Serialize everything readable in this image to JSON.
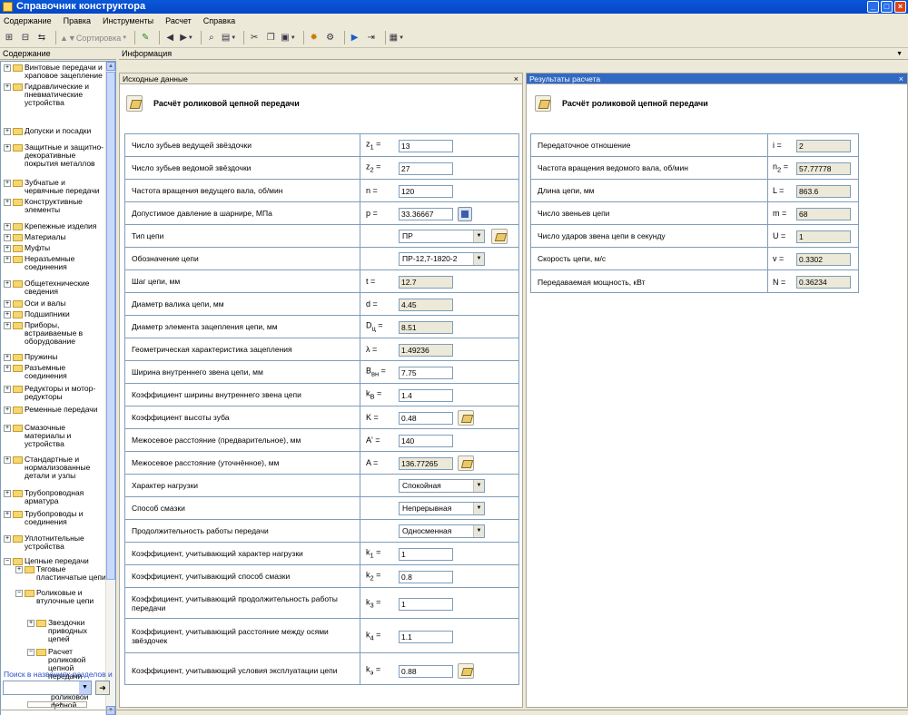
{
  "window": {
    "title": "Справочник конструктора"
  },
  "menu": [
    "Содержание",
    "Правка",
    "Инструменты",
    "Расчет",
    "Справка"
  ],
  "toolbar": {
    "sort_label": "Сортировка"
  },
  "left_pane": {
    "header": "Содержание",
    "tree": [
      {
        "label": "Винтовые передачи и храповое зацепление",
        "level": 0,
        "expander": "+"
      },
      {
        "label": "Гидравлические и пневматические устройства",
        "level": 0,
        "expander": "+"
      },
      {
        "label": "Допуски и посадки",
        "level": 0,
        "expander": "+"
      },
      {
        "label": "Защитные и защитно-декоративные покрытия металлов",
        "level": 0,
        "expander": "+"
      },
      {
        "label": "Зубчатые и червячные передачи",
        "level": 0,
        "expander": "+"
      },
      {
        "label": "Конструктивные элементы",
        "level": 0,
        "expander": "+"
      },
      {
        "label": "Крепежные изделия",
        "level": 0,
        "expander": "+"
      },
      {
        "label": "Материалы",
        "level": 0,
        "expander": "+"
      },
      {
        "label": "Муфты",
        "level": 0,
        "expander": "+"
      },
      {
        "label": "Неразъемные соединения",
        "level": 0,
        "expander": "+"
      },
      {
        "label": "Общетехнические сведения",
        "level": 0,
        "expander": "+"
      },
      {
        "label": "Оси и валы",
        "level": 0,
        "expander": "+"
      },
      {
        "label": "Подшипники",
        "level": 0,
        "expander": "+"
      },
      {
        "label": "Приборы, встраиваемые в оборудование",
        "level": 0,
        "expander": "+"
      },
      {
        "label": "Пружины",
        "level": 0,
        "expander": "+"
      },
      {
        "label": "Разъемные соединения",
        "level": 0,
        "expander": "+"
      },
      {
        "label": "Редукторы и мотор-редукторы",
        "level": 0,
        "expander": "+"
      },
      {
        "label": "Ременные передачи",
        "level": 0,
        "expander": "+"
      },
      {
        "label": "Смазочные материалы и устройства",
        "level": 0,
        "expander": "+"
      },
      {
        "label": "Стандартные и нормализованные детали и узлы",
        "level": 0,
        "expander": "+"
      },
      {
        "label": "Трубопроводная арматура",
        "level": 0,
        "expander": "+"
      },
      {
        "label": "Трубопроводы и соединения",
        "level": 0,
        "expander": "+"
      },
      {
        "label": "Уплотнительные устройства",
        "level": 0,
        "expander": "+"
      },
      {
        "label": "Цепные передачи",
        "level": 0,
        "expander": "−"
      },
      {
        "label": "Тяговые пластинчатые цепи",
        "level": 1,
        "expander": "+"
      },
      {
        "label": "Роликовые и втулочные цепи",
        "level": 1,
        "expander": "−"
      },
      {
        "label": "Звездочки приводных цепей",
        "level": 2,
        "expander": "+"
      },
      {
        "label": "Расчет роликовой цепной передачи",
        "level": 2,
        "expander": "−"
      },
      {
        "label": "Расчет роликовой цепной",
        "level": 3,
        "expander": ""
      }
    ],
    "search_label": "Поиск в названиях разделов и",
    "search_value": ""
  },
  "info": {
    "header": "Информация"
  },
  "input_panel": {
    "header": "Исходные данные",
    "title": "Расчёт роликовой цепной передачи",
    "rows": [
      {
        "label": "Число зубьев ведущей звёздочки",
        "sym": "z",
        "sub": "1",
        "eq": " =",
        "value": "13",
        "kind": "input"
      },
      {
        "label": "Число зубьев ведомой звёздочки",
        "sym": "z",
        "sub": "2",
        "eq": " =",
        "value": "27",
        "kind": "input"
      },
      {
        "label": "Частота вращения ведущего вала, об/мин",
        "sym": "n =",
        "sub": "",
        "eq": "",
        "value": "120",
        "kind": "input"
      },
      {
        "label": "Допустимое давление в шарнире, МПа",
        "sym": "p =",
        "sub": "",
        "eq": "",
        "value": "33.36667",
        "kind": "input",
        "extra": "calc"
      },
      {
        "label": "Тип цепи",
        "sym": "",
        "sub": "",
        "eq": "",
        "value": "ПР",
        "kind": "select",
        "extra": "book"
      },
      {
        "label": "Обозначение цепи",
        "sym": "",
        "sub": "",
        "eq": "",
        "value": "ПР-12,7-1820-2",
        "kind": "select"
      },
      {
        "label": "Шаг цепи, мм",
        "sym": "t =",
        "sub": "",
        "eq": "",
        "value": "12.7",
        "kind": "readonly"
      },
      {
        "label": "Диаметр валика цепи, мм",
        "sym": "d =",
        "sub": "",
        "eq": "",
        "value": "4.45",
        "kind": "readonly"
      },
      {
        "label": "Диаметр элемента зацепления цепи, мм",
        "sym": "D",
        "sub": "ц",
        "eq": " =",
        "value": "8.51",
        "kind": "readonly"
      },
      {
        "label": "Геометрическая характеристика зацепления",
        "sym": "λ =",
        "sub": "",
        "eq": "",
        "value": "1.49236",
        "kind": "readonly"
      },
      {
        "label": "Ширина внутреннего звена цепи, мм",
        "sym": "B",
        "sub": "вн",
        "eq": " =",
        "value": "7.75",
        "kind": "input"
      },
      {
        "label": "Коэффициент ширины внутреннего звена цепи",
        "sym": "k",
        "sub": "B",
        "eq": " =",
        "value": "1.4",
        "kind": "input"
      },
      {
        "label": "Коэффициент высоты зуба",
        "sym": "K =",
        "sub": "",
        "eq": "",
        "value": "0.48",
        "kind": "input",
        "extra": "book"
      },
      {
        "label": "Межосевое расстояние (предварительное), мм",
        "sym": "A' =",
        "sub": "",
        "eq": "",
        "value": "140",
        "kind": "input"
      },
      {
        "label": "Межосевое расстояние (уточнённое), мм",
        "sym": "A =",
        "sub": "",
        "eq": "",
        "value": "136.77265",
        "kind": "readonly",
        "extra": "book"
      },
      {
        "label": "Характер нагрузки",
        "sym": "",
        "sub": "",
        "eq": "",
        "value": "Спокойная",
        "kind": "select"
      },
      {
        "label": "Способ смазки",
        "sym": "",
        "sub": "",
        "eq": "",
        "value": "Непрерывная",
        "kind": "select"
      },
      {
        "label": "Продолжительность работы передачи",
        "sym": "",
        "sub": "",
        "eq": "",
        "value": "Односменная",
        "kind": "select"
      },
      {
        "label": "Коэффициент, учитывающий характер нагрузки",
        "sym": "k",
        "sub": "1",
        "eq": " =",
        "value": "1",
        "kind": "input"
      },
      {
        "label": "Коэффициент, учитывающий способ смазки",
        "sym": "k",
        "sub": "2",
        "eq": " =",
        "value": "0.8",
        "kind": "input"
      },
      {
        "label": "Коэффициент, учитывающий продолжительность работы передачи",
        "sym": "k",
        "sub": "3",
        "eq": " =",
        "value": "1",
        "kind": "input"
      },
      {
        "label": "Коэффициент, учитывающий расстояние между осями звёздочек",
        "sym": "k",
        "sub": "4",
        "eq": " =",
        "value": "1.1",
        "kind": "input"
      },
      {
        "label": "Коэффициент, учитывающий условия эксплуатации цепи",
        "sym": "k",
        "sub": "э",
        "eq": " =",
        "value": "0.88",
        "kind": "input",
        "extra": "book"
      }
    ]
  },
  "result_panel": {
    "header": "Результаты расчета",
    "title": "Расчёт роликовой цепной передачи",
    "rows": [
      {
        "label": "Передаточное отношение",
        "sym": "i =",
        "sub": "",
        "eq": "",
        "value": "2"
      },
      {
        "label": "Частота вращения ведомого вала, об/мин",
        "sym": "n",
        "sub": "2",
        "eq": " =",
        "value": "57.77778"
      },
      {
        "label": "Длина цепи, мм",
        "sym": "L =",
        "sub": "",
        "eq": "",
        "value": "863.6"
      },
      {
        "label": "Число звеньев цепи",
        "sym": "m =",
        "sub": "",
        "eq": "",
        "value": "68"
      },
      {
        "label": "Число ударов звена цепи в секунду",
        "sym": "U =",
        "sub": "",
        "eq": "",
        "value": "1"
      },
      {
        "label": "Скорость цепи, м/с",
        "sym": "v =",
        "sub": "",
        "eq": "",
        "value": "0.3302"
      },
      {
        "label": "Передаваемая мощность, кВт",
        "sym": "N =",
        "sub": "",
        "eq": "",
        "value": "0.36234"
      }
    ]
  }
}
